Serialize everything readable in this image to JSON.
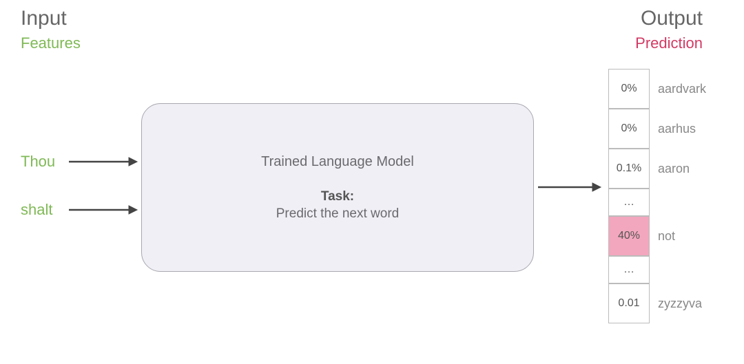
{
  "input": {
    "title": "Input",
    "features_label": "Features",
    "words": [
      "Thou",
      "shalt"
    ]
  },
  "model": {
    "title": "Trained Language Model",
    "task_label": "Task:",
    "task_desc": "Predict the next word"
  },
  "output": {
    "title": "Output",
    "prediction_label": "Prediction",
    "predictions": [
      {
        "prob": "0%",
        "word": "aardvark",
        "highlight": false,
        "short": false
      },
      {
        "prob": "0%",
        "word": "aarhus",
        "highlight": false,
        "short": false
      },
      {
        "prob": "0.1%",
        "word": "aaron",
        "highlight": false,
        "short": false
      },
      {
        "prob": "…",
        "word": "",
        "highlight": false,
        "short": true
      },
      {
        "prob": "40%",
        "word": "not",
        "highlight": true,
        "short": false
      },
      {
        "prob": "…",
        "word": "",
        "highlight": false,
        "short": true
      },
      {
        "prob": "0.01",
        "word": "zyzzyva",
        "highlight": false,
        "short": false
      }
    ]
  }
}
